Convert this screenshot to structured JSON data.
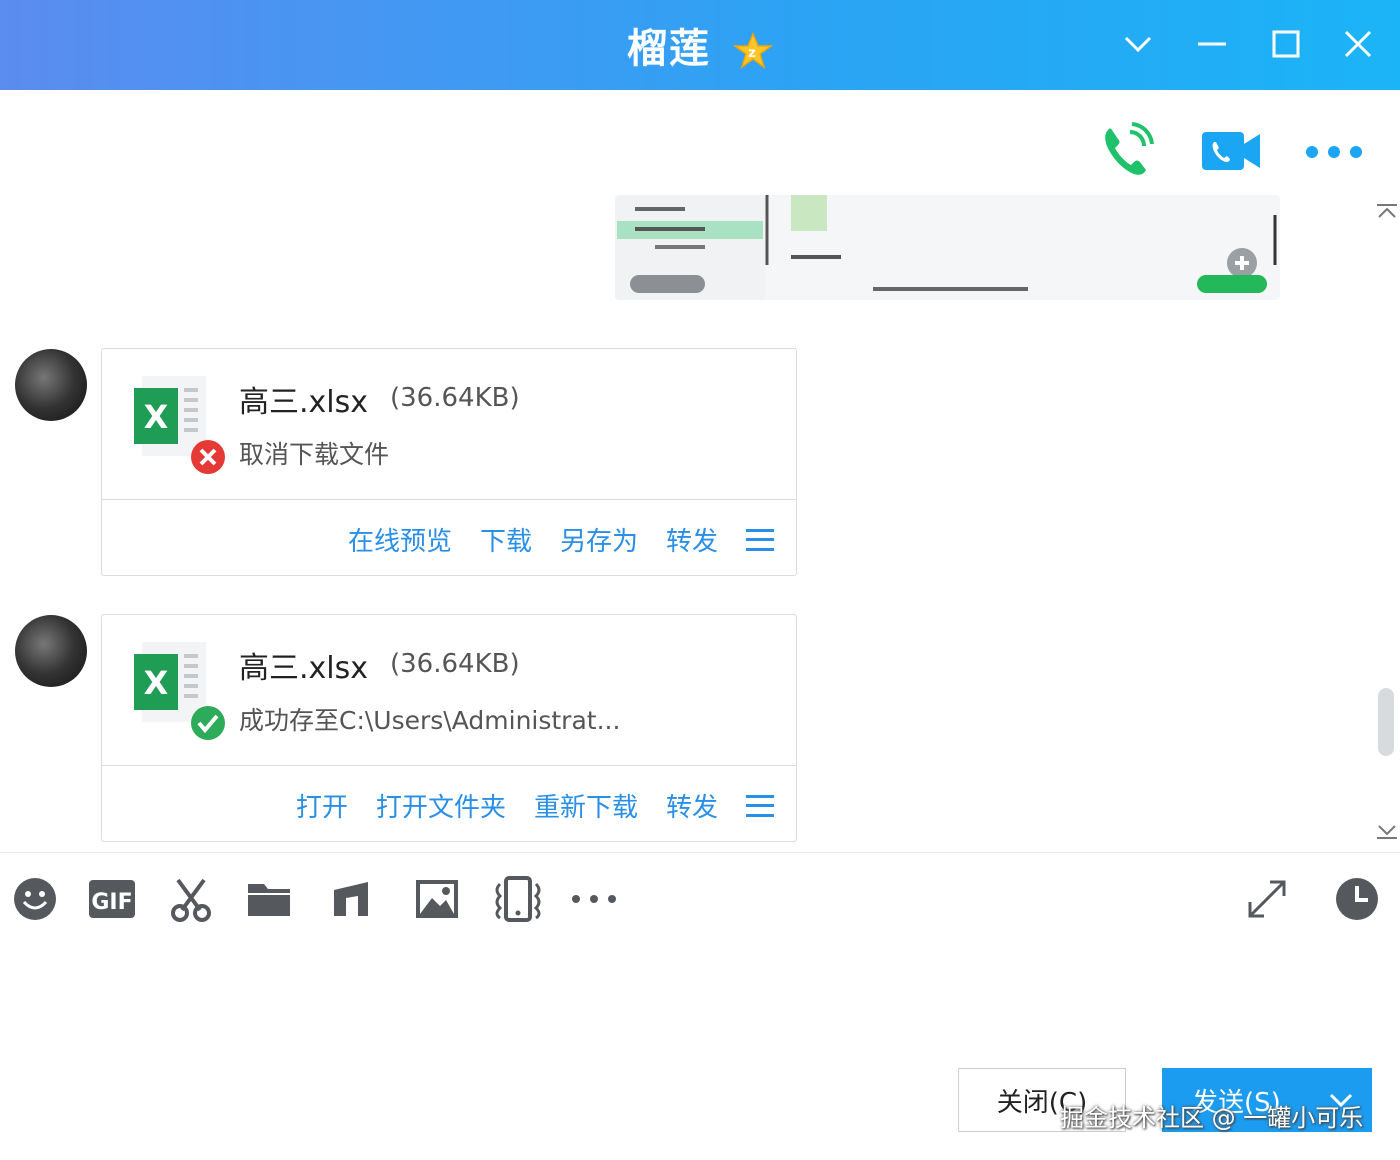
{
  "window": {
    "title": "榴莲"
  },
  "messages": [
    {
      "file_name": "高三.xlsx",
      "file_size": "(36.64KB)",
      "status": "取消下载文件",
      "status_kind": "cancelled",
      "actions": [
        "在线预览",
        "下载",
        "另存为",
        "转发"
      ]
    },
    {
      "file_name": "高三.xlsx",
      "file_size": "(36.64KB)",
      "status": "成功存至C:\\Users\\Administrat...",
      "status_kind": "success",
      "actions": [
        "打开",
        "打开文件夹",
        "重新下载",
        "转发"
      ]
    }
  ],
  "composer": {
    "close_label": "关闭(C)",
    "send_label": "发送(S)"
  },
  "watermark": "掘金技术社区 @ 一罐小可乐",
  "colors": {
    "accent": "#2a8fe6",
    "send": "#1c9cf0",
    "excel": "#1f9d55",
    "error": "#e53935",
    "success": "#2eab5a"
  }
}
